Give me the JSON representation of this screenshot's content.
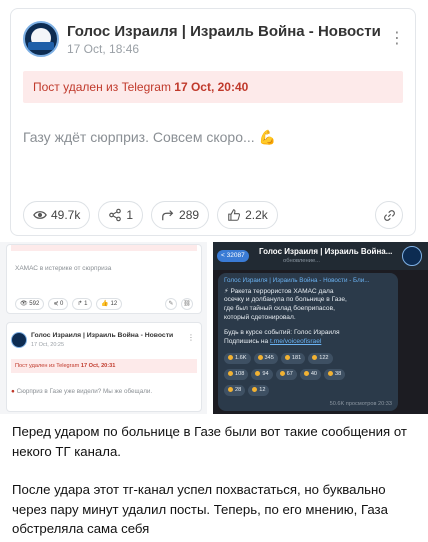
{
  "top_post": {
    "channel_name": "Голос Израиля | Израиль Война - Новости",
    "date": "17 Oct, 18:46",
    "deleted_prefix": "Пост удален из Telegram ",
    "deleted_date": "17 Oct, 20:40",
    "text": "Газу ждёт сюрприз. Совсем скоро...",
    "text_emoji": "💪",
    "stats": {
      "views": "49.7k",
      "shares": "1",
      "forwards": "289",
      "likes": "2.2k"
    }
  },
  "left_screenshot": {
    "post1_text": "ХАМАС в истерике от сюрприза",
    "post1_stats": [
      "592",
      "0",
      "1",
      "12"
    ],
    "post2_channel": "Голос Израиля | Израиль Война - Новости",
    "post2_date": "17 Oct, 20:25",
    "post2_deleted_prefix": "Пост удален из Telegram ",
    "post2_deleted_date": "17 Oct, 20:31",
    "post2_text": "Сюрприз в Газе уже видели? Мы же обещали."
  },
  "telegram": {
    "unread_badge": "32087",
    "title": "Голос Израиля | Израиль Война...",
    "subtitle": "обновление...",
    "channel_line": "Голос Израиля | Израиль Война - Новости - Бли...",
    "lines": [
      "⚡ Ракета террористов ХАМАС дала",
      "осечку и долбанула по больнице в Газе,",
      "где был тайный склад боеприпасов,",
      "который сдетонировал."
    ],
    "cta_line": "Будь в курсе событий: Голос Израиля",
    "subscribe_prefix": "Подпишись на ",
    "subscribe_link": "t.me/voiceofisrael",
    "reactions_row1": [
      "1.6K",
      "345",
      "181",
      "122"
    ],
    "reactions_row2": [
      "108",
      "94",
      "67",
      "40",
      "38"
    ],
    "reactions_row3": [
      "28",
      "12"
    ],
    "footer": "50.6K просмотров 20:33"
  },
  "caption": {
    "paragraph1": "Перед ударом по больнице в Газе были вот такие сообщения от некого ТГ канала.",
    "paragraph2": "После удара этот тг-канал успел похвастаться, но буквально через пару минут удалил посты. Теперь, по его мнению, Газа обстреляла сама себя"
  },
  "colors": {
    "deleted_bg": "#fdeaea",
    "deleted_text": "#c0392b",
    "telegram_bg": "#1c1c22",
    "telegram_bubble": "#2b3a4a",
    "telegram_link": "#6ab2f2"
  },
  "icons": [
    "eye-icon",
    "share-icon",
    "forward-icon",
    "thumbs-up-icon",
    "link-icon",
    "more-vertical-icon"
  ]
}
